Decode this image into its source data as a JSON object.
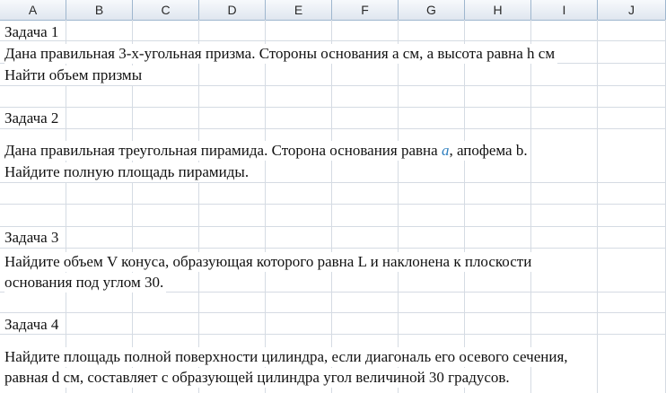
{
  "columns": [
    "A",
    "B",
    "C",
    "D",
    "E",
    "F",
    "G",
    "H",
    "I",
    "J"
  ],
  "rows": [
    {
      "name": "task1-title",
      "text": "Задача 1"
    },
    {
      "name": "task1-line1",
      "text": "Дана правильная 3-х-угольная призма. Стороны основания а см, а высота равна h см"
    },
    {
      "name": "task1-line2",
      "text": "Найти объем призмы"
    },
    {
      "name": "task2-title",
      "text": "Задача 2"
    },
    {
      "name": "task2-line1a",
      "text": "Дана правильная треугольная пирамида. Сторона основания равна "
    },
    {
      "name": "task2-line1-var",
      "text": "a"
    },
    {
      "name": "task2-line1b",
      "text": ", апофема b."
    },
    {
      "name": "task2-line2",
      "text": "Найдите полную площадь пирамиды."
    },
    {
      "name": "task3-title",
      "text": "Задача 3"
    },
    {
      "name": "task3-line1",
      "text": "Найдите объем V конуса, образующая которого равна L и наклонена к плоскости"
    },
    {
      "name": "task3-line2",
      "text": " основания под углом 30."
    },
    {
      "name": "task4-title",
      "text": "Задача 4"
    },
    {
      "name": "task4-line1",
      "text": "Найдите площадь полной поверхности цилиндра, если диагональ его осевого сечения,"
    },
    {
      "name": "task4-line2",
      "text": "равная d см, составляет с образующей цилиндра угол величиной 30 градусов."
    }
  ],
  "colors": {
    "grid": "#d5dbe3",
    "header_border": "#9eb6ce",
    "math_variable": "#2f7fbf"
  }
}
